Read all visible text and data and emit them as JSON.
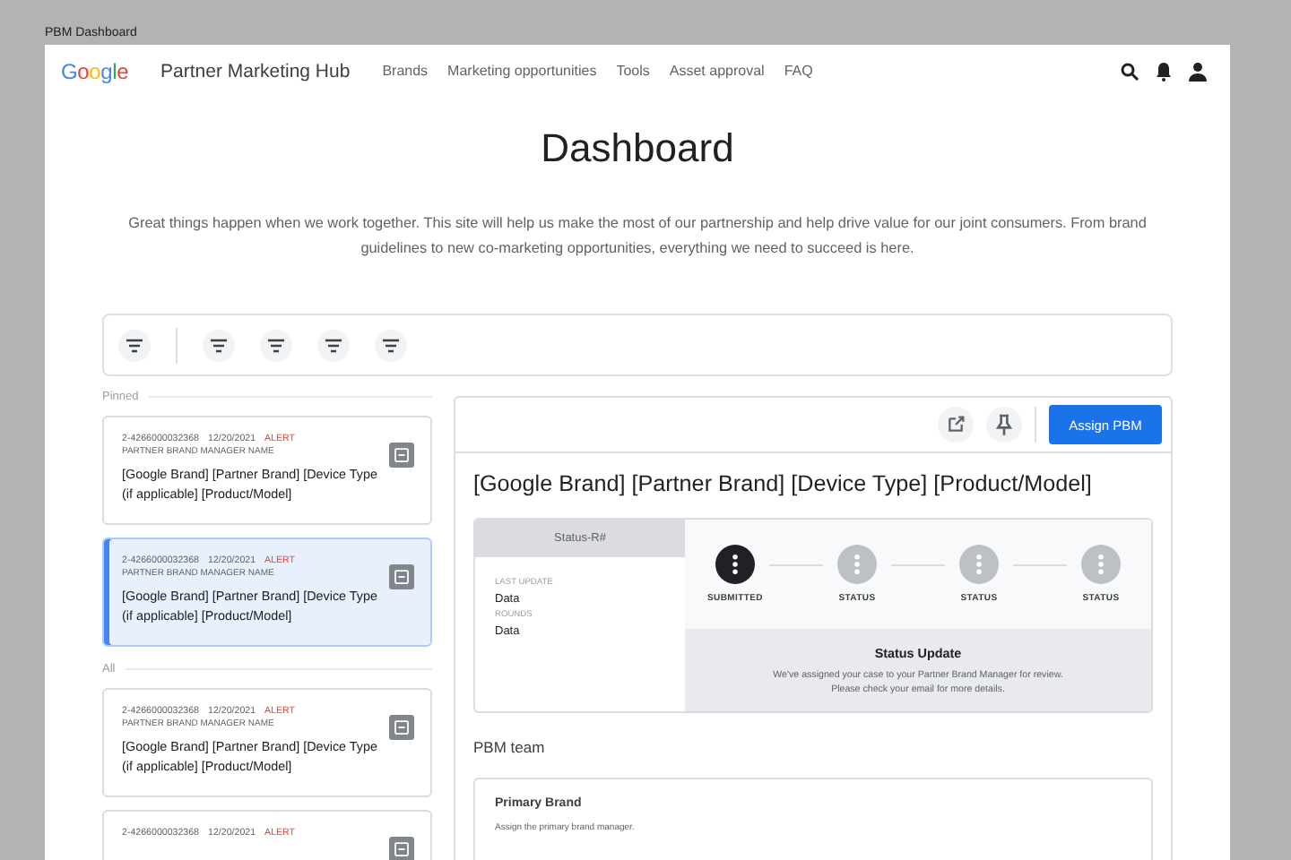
{
  "window": {
    "title": "PBM Dashboard"
  },
  "nav": {
    "logo": "Google",
    "title": "Partner Marketing Hub",
    "links": [
      "Brands",
      "Marketing opportunities",
      "Tools",
      "Asset approval",
      "FAQ"
    ]
  },
  "page": {
    "heading": "Dashboard",
    "intro": "Great things happen when we work together. This site will help us make the most of our partnership and help drive value for our joint consumers. From brand guidelines to new co-marketing opportunities, everything we need to succeed is here."
  },
  "filters": [
    {
      "kind": "filter"
    },
    {
      "kind": "filter"
    },
    {
      "kind": "filter"
    },
    {
      "kind": "filter"
    },
    {
      "kind": "filter"
    }
  ],
  "sections": [
    {
      "label": "Pinned",
      "cards": [
        {
          "id": "2-4266000032368",
          "date": "12/20/2021",
          "alert": "ALERT",
          "manager": "PARTNER BRAND MANAGER NAME",
          "title": "[Google Brand] [Partner Brand] [Device Type (if applicable] [Product/Model]",
          "selected": false
        },
        {
          "id": "2-4266000032368",
          "date": "12/20/2021",
          "alert": "ALERT",
          "manager": "PARTNER BRAND MANAGER NAME",
          "title": "[Google Brand] [Partner Brand] [Device Type (if applicable] [Product/Model]",
          "selected": true
        }
      ]
    },
    {
      "label": "All",
      "cards": [
        {
          "id": "2-4266000032368",
          "date": "12/20/2021",
          "alert": "ALERT",
          "manager": "PARTNER BRAND MANAGER NAME",
          "title": "[Google Brand] [Partner Brand] [Device Type (if applicable] [Product/Model]",
          "selected": false
        },
        {
          "id": "2-4266000032368",
          "date": "12/20/2021",
          "alert": "ALERT",
          "selected": false
        }
      ]
    }
  ],
  "detail": {
    "assign_button": "Assign PBM",
    "title": "[Google Brand] [Partner Brand] [Device Type] [Product/Model]",
    "status_header": "Status-R#",
    "fields": [
      {
        "label": "LAST UPDATE",
        "value": "Data"
      },
      {
        "label": "ROUNDS",
        "value": "Data"
      }
    ],
    "steps": [
      {
        "label": "SUBMITTED",
        "done": true
      },
      {
        "label": "STATUS",
        "done": false
      },
      {
        "label": "STATUS",
        "done": false
      },
      {
        "label": "STATUS",
        "done": false
      }
    ],
    "update": {
      "title": "Status Update",
      "lines": [
        "We've assigned your case to your Partner Brand Manager for review.",
        "Please check your email for more details."
      ]
    },
    "team_heading": "PBM team",
    "team_card": {
      "title": "Primary Brand",
      "text": "Assign the primary brand manager."
    }
  }
}
